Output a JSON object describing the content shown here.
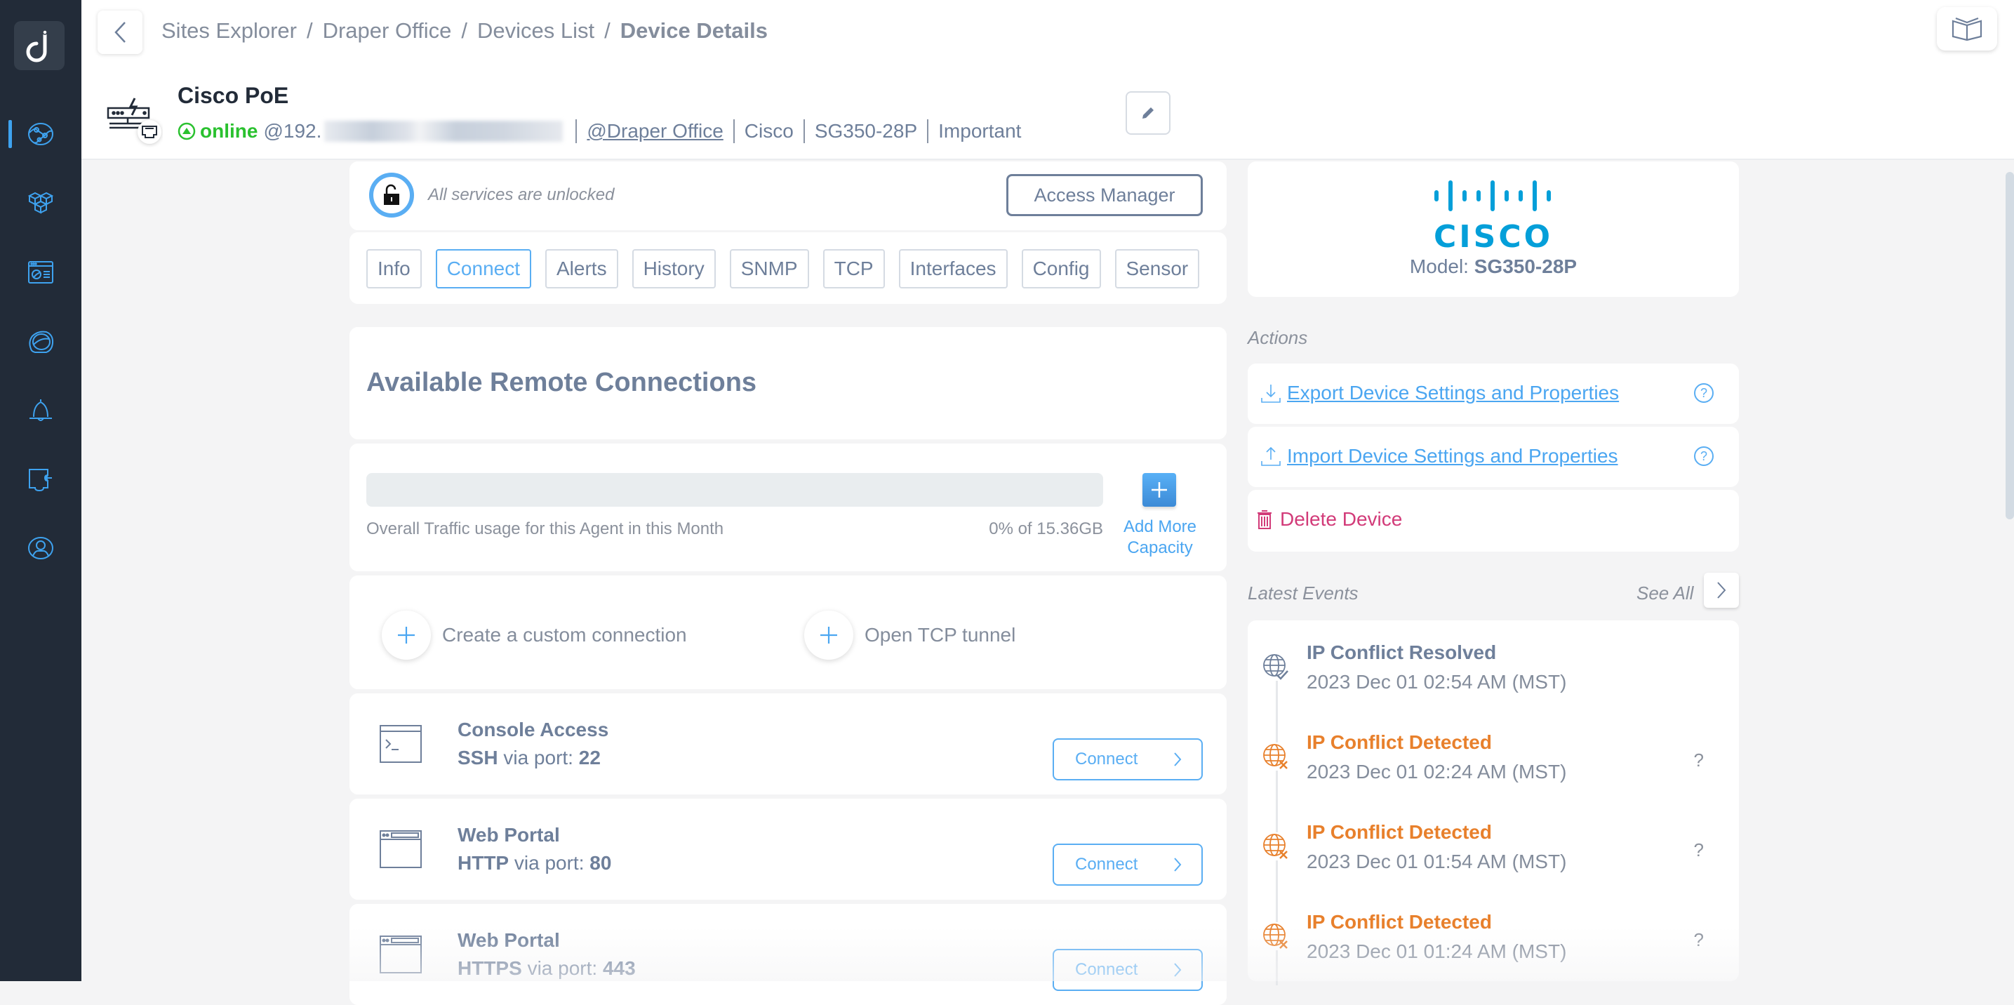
{
  "sidebar": {
    "items": [
      {
        "id": "sites",
        "icon": "globe-network-icon",
        "active": true
      },
      {
        "id": "inventory",
        "icon": "cubes-icon",
        "active": false
      },
      {
        "id": "dashboard",
        "icon": "dashboard-window-icon",
        "active": false
      },
      {
        "id": "monitoring",
        "icon": "speedometer-icon",
        "active": false
      },
      {
        "id": "alerts",
        "icon": "bell-icon",
        "active": false
      },
      {
        "id": "integrations",
        "icon": "puzzle-plugin-icon",
        "active": false
      },
      {
        "id": "account",
        "icon": "user-circle-icon",
        "active": false
      }
    ]
  },
  "breadcrumb": {
    "items": [
      "Sites Explorer",
      "Draper Office",
      "Devices List"
    ],
    "separator": "/",
    "current": "Device Details"
  },
  "device": {
    "name": "Cisco PoE",
    "status": "online",
    "ip_prefix": "@192.",
    "site_link": "@Draper Office",
    "vendor": "Cisco",
    "model": "SG350-28P",
    "importance": "Important"
  },
  "access": {
    "status_text": "All services are unlocked",
    "button_label": "Access Manager"
  },
  "tabs": [
    {
      "label": "Info",
      "active": false
    },
    {
      "label": "Connect",
      "active": true
    },
    {
      "label": "Alerts",
      "active": false
    },
    {
      "label": "History",
      "active": false
    },
    {
      "label": "SNMP",
      "active": false
    },
    {
      "label": "TCP",
      "active": false
    },
    {
      "label": "Interfaces",
      "active": false
    },
    {
      "label": "Config",
      "active": false
    },
    {
      "label": "Sensor",
      "active": false
    }
  ],
  "remote": {
    "title": "Available Remote Connections",
    "traffic_label": "Overall Traffic usage for this Agent in this Month",
    "traffic_value": "0% of 15.36GB",
    "traffic_percent": 0,
    "add_capacity_line1": "Add More",
    "add_capacity_line2": "Capacity",
    "create_custom": "Create a custom connection",
    "open_tunnel": "Open TCP tunnel",
    "connections": [
      {
        "title": "Console Access",
        "protocol": "SSH",
        "via": "via port:",
        "port": "22",
        "icon": "terminal-icon",
        "button": "Connect"
      },
      {
        "title": "Web Portal",
        "protocol": "HTTP",
        "via": "via port:",
        "port": "80",
        "icon": "browser-window-icon",
        "button": "Connect"
      },
      {
        "title": "Web Portal",
        "protocol": "HTTPS",
        "via": "via port:",
        "port": "443",
        "icon": "browser-window-icon",
        "button": "Connect"
      }
    ]
  },
  "vendor_card": {
    "logo_text": "CISCO",
    "model_label": "Model:",
    "model_value": "SG350-28P",
    "brand_color": "#049fd9"
  },
  "actions": {
    "label": "Actions",
    "export": "Export Device Settings and Properties",
    "import": "Import Device Settings and Properties",
    "delete": "Delete Device",
    "help": "?"
  },
  "events": {
    "label": "Latest Events",
    "see_all": "See All",
    "items": [
      {
        "title": "IP Conflict Resolved",
        "time": "2023 Dec 01 02:54 AM (MST)",
        "type": "resolved",
        "color": "#6e7f9a",
        "help": ""
      },
      {
        "title": "IP Conflict Detected",
        "time": "2023 Dec 01 02:24 AM (MST)",
        "type": "detected",
        "color": "#e8802c",
        "help": "?"
      },
      {
        "title": "IP Conflict Detected",
        "time": "2023 Dec 01 01:54 AM (MST)",
        "type": "detected",
        "color": "#e8802c",
        "help": "?"
      },
      {
        "title": "IP Conflict Detected",
        "time": "2023 Dec 01 01:24 AM (MST)",
        "type": "detected",
        "color": "#e8802c",
        "help": "?"
      }
    ]
  },
  "colors": {
    "accent": "#5aaef3",
    "online": "#2ac12f",
    "warning": "#e8802c",
    "danger": "#d23b79",
    "sidebar_bg": "#222b38"
  }
}
